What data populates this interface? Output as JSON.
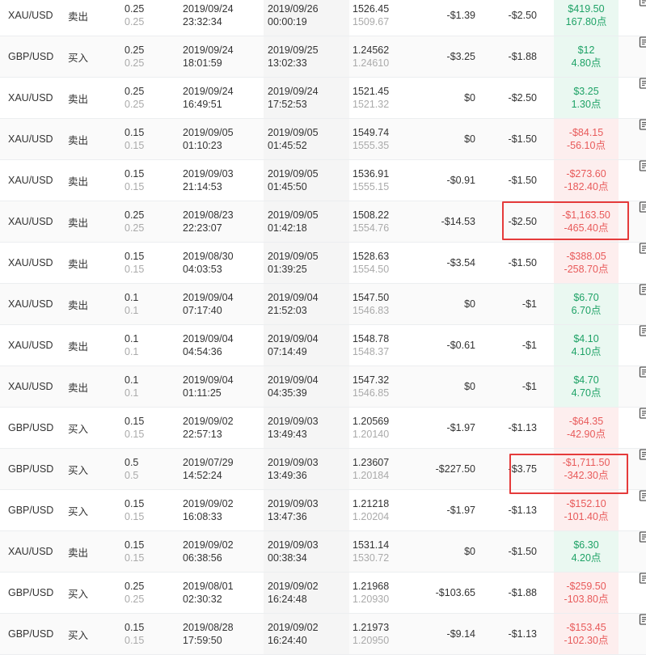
{
  "rows": [
    {
      "symbol": "XAU/USD",
      "side": "卖出",
      "volume": "0.25",
      "volume_sub": "0.25",
      "open_date": "2019/09/24",
      "open_time": "23:32:34",
      "close_date": "2019/09/26",
      "close_time": "00:00:19",
      "price": "1526.45",
      "price_sub": "1509.67",
      "swap": "-$1.39",
      "commission": "-$2.50",
      "profit": "$419.50",
      "profit_points": "167.80点",
      "sign": "pos"
    },
    {
      "symbol": "GBP/USD",
      "side": "买入",
      "volume": "0.25",
      "volume_sub": "0.25",
      "open_date": "2019/09/24",
      "open_time": "18:01:59",
      "close_date": "2019/09/25",
      "close_time": "13:02:33",
      "price": "1.24562",
      "price_sub": "1.24610",
      "swap": "-$3.25",
      "commission": "-$1.88",
      "profit": "$12",
      "profit_points": "4.80点",
      "sign": "pos"
    },
    {
      "symbol": "XAU/USD",
      "side": "卖出",
      "volume": "0.25",
      "volume_sub": "0.25",
      "open_date": "2019/09/24",
      "open_time": "16:49:51",
      "close_date": "2019/09/24",
      "close_time": "17:52:53",
      "price": "1521.45",
      "price_sub": "1521.32",
      "swap": "$0",
      "commission": "-$2.50",
      "profit": "$3.25",
      "profit_points": "1.30点",
      "sign": "pos"
    },
    {
      "symbol": "XAU/USD",
      "side": "卖出",
      "volume": "0.15",
      "volume_sub": "0.15",
      "open_date": "2019/09/05",
      "open_time": "01:10:23",
      "close_date": "2019/09/05",
      "close_time": "01:45:52",
      "price": "1549.74",
      "price_sub": "1555.35",
      "swap": "$0",
      "commission": "-$1.50",
      "profit": "-$84.15",
      "profit_points": "-56.10点",
      "sign": "neg"
    },
    {
      "symbol": "XAU/USD",
      "side": "卖出",
      "volume": "0.15",
      "volume_sub": "0.15",
      "open_date": "2019/09/03",
      "open_time": "21:14:53",
      "close_date": "2019/09/05",
      "close_time": "01:45:50",
      "price": "1536.91",
      "price_sub": "1555.15",
      "swap": "-$0.91",
      "commission": "-$1.50",
      "profit": "-$273.60",
      "profit_points": "-182.40点",
      "sign": "neg"
    },
    {
      "symbol": "XAU/USD",
      "side": "卖出",
      "volume": "0.25",
      "volume_sub": "0.25",
      "open_date": "2019/08/23",
      "open_time": "22:23:07",
      "close_date": "2019/09/05",
      "close_time": "01:42:18",
      "price": "1508.22",
      "price_sub": "1554.76",
      "swap": "-$14.53",
      "commission": "-$2.50",
      "profit": "-$1,163.50",
      "profit_points": "-465.40点",
      "sign": "neg"
    },
    {
      "symbol": "XAU/USD",
      "side": "卖出",
      "volume": "0.15",
      "volume_sub": "0.15",
      "open_date": "2019/08/30",
      "open_time": "04:03:53",
      "close_date": "2019/09/05",
      "close_time": "01:39:25",
      "price": "1528.63",
      "price_sub": "1554.50",
      "swap": "-$3.54",
      "commission": "-$1.50",
      "profit": "-$388.05",
      "profit_points": "-258.70点",
      "sign": "neg"
    },
    {
      "symbol": "XAU/USD",
      "side": "卖出",
      "volume": "0.1",
      "volume_sub": "0.1",
      "open_date": "2019/09/04",
      "open_time": "07:17:40",
      "close_date": "2019/09/04",
      "close_time": "21:52:03",
      "price": "1547.50",
      "price_sub": "1546.83",
      "swap": "$0",
      "commission": "-$1",
      "profit": "$6.70",
      "profit_points": "6.70点",
      "sign": "pos"
    },
    {
      "symbol": "XAU/USD",
      "side": "卖出",
      "volume": "0.1",
      "volume_sub": "0.1",
      "open_date": "2019/09/04",
      "open_time": "04:54:36",
      "close_date": "2019/09/04",
      "close_time": "07:14:49",
      "price": "1548.78",
      "price_sub": "1548.37",
      "swap": "-$0.61",
      "commission": "-$1",
      "profit": "$4.10",
      "profit_points": "4.10点",
      "sign": "pos"
    },
    {
      "symbol": "XAU/USD",
      "side": "卖出",
      "volume": "0.1",
      "volume_sub": "0.1",
      "open_date": "2019/09/04",
      "open_time": "01:11:25",
      "close_date": "2019/09/04",
      "close_time": "04:35:39",
      "price": "1547.32",
      "price_sub": "1546.85",
      "swap": "$0",
      "commission": "-$1",
      "profit": "$4.70",
      "profit_points": "4.70点",
      "sign": "pos"
    },
    {
      "symbol": "GBP/USD",
      "side": "买入",
      "volume": "0.15",
      "volume_sub": "0.15",
      "open_date": "2019/09/02",
      "open_time": "22:57:13",
      "close_date": "2019/09/03",
      "close_time": "13:49:43",
      "price": "1.20569",
      "price_sub": "1.20140",
      "swap": "-$1.97",
      "commission": "-$1.13",
      "profit": "-$64.35",
      "profit_points": "-42.90点",
      "sign": "neg"
    },
    {
      "symbol": "GBP/USD",
      "side": "买入",
      "volume": "0.5",
      "volume_sub": "0.5",
      "open_date": "2019/07/29",
      "open_time": "14:52:24",
      "close_date": "2019/09/03",
      "close_time": "13:49:36",
      "price": "1.23607",
      "price_sub": "1.20184",
      "swap": "-$227.50",
      "commission": "-$3.75",
      "profit": "-$1,711.50",
      "profit_points": "-342.30点",
      "sign": "neg"
    },
    {
      "symbol": "GBP/USD",
      "side": "买入",
      "volume": "0.15",
      "volume_sub": "0.15",
      "open_date": "2019/09/02",
      "open_time": "16:08:33",
      "close_date": "2019/09/03",
      "close_time": "13:47:36",
      "price": "1.21218",
      "price_sub": "1.20204",
      "swap": "-$1.97",
      "commission": "-$1.13",
      "profit": "-$152.10",
      "profit_points": "-101.40点",
      "sign": "neg"
    },
    {
      "symbol": "XAU/USD",
      "side": "卖出",
      "volume": "0.15",
      "volume_sub": "0.15",
      "open_date": "2019/09/02",
      "open_time": "06:38:56",
      "close_date": "2019/09/03",
      "close_time": "00:38:34",
      "price": "1531.14",
      "price_sub": "1530.72",
      "swap": "$0",
      "commission": "-$1.50",
      "profit": "$6.30",
      "profit_points": "4.20点",
      "sign": "pos"
    },
    {
      "symbol": "GBP/USD",
      "side": "买入",
      "volume": "0.25",
      "volume_sub": "0.25",
      "open_date": "2019/08/01",
      "open_time": "02:30:32",
      "close_date": "2019/09/02",
      "close_time": "16:24:48",
      "price": "1.21968",
      "price_sub": "1.20930",
      "swap": "-$103.65",
      "commission": "-$1.88",
      "profit": "-$259.50",
      "profit_points": "-103.80点",
      "sign": "neg"
    },
    {
      "symbol": "GBP/USD",
      "side": "买入",
      "volume": "0.15",
      "volume_sub": "0.15",
      "open_date": "2019/08/28",
      "open_time": "17:59:50",
      "close_date": "2019/09/02",
      "close_time": "16:24:40",
      "price": "1.21973",
      "price_sub": "1.20950",
      "swap": "-$9.14",
      "commission": "-$1.13",
      "profit": "-$153.45",
      "profit_points": "-102.30点",
      "sign": "neg"
    }
  ],
  "highlights": [
    {
      "row": 5
    },
    {
      "row": 11
    }
  ],
  "colors": {
    "profit_positive": "#1ea266",
    "profit_negative": "#e85a5a",
    "highlight_border": "#e53b3b"
  }
}
